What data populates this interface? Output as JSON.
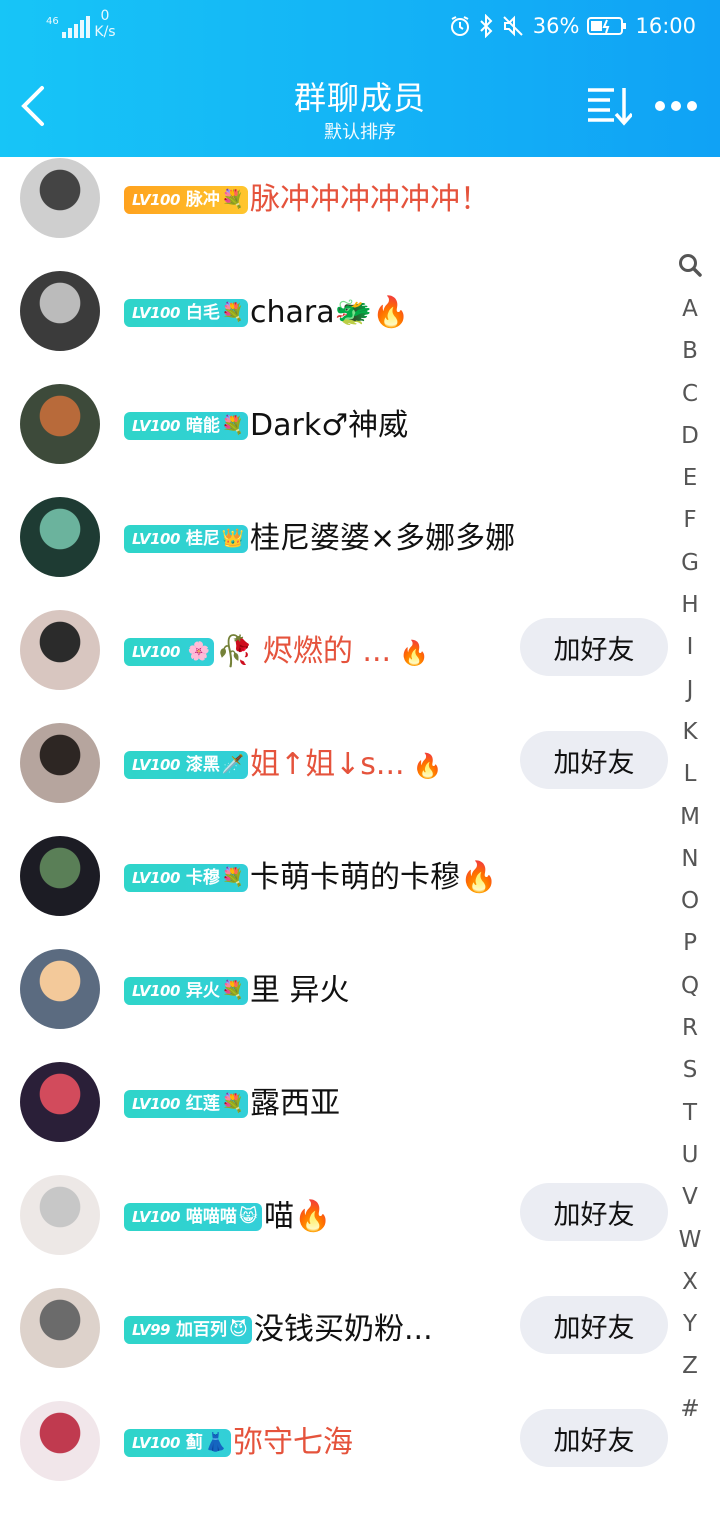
{
  "status_bar": {
    "network_type": "46",
    "net_speed_value": "0",
    "net_speed_unit": "K/s",
    "battery_percent": "36%",
    "time": "16:00"
  },
  "header": {
    "title": "群聊成员",
    "subtitle": "默认排序"
  },
  "add_friend_label": "加好友",
  "members": [
    {
      "level": "LV100",
      "title": "脉冲",
      "title_emoji": "💐",
      "name": "脉冲冲冲冲冲冲！",
      "name_red": true,
      "suffix": "",
      "badge_gold": true,
      "add_friend": false
    },
    {
      "level": "LV100",
      "title": "白毛",
      "title_emoji": "💐",
      "name": "chara🐲🔥",
      "name_red": false,
      "suffix": "",
      "badge_gold": false,
      "add_friend": false
    },
    {
      "level": "LV100",
      "title": "暗能",
      "title_emoji": "💐",
      "name": "Dark♂神威",
      "name_red": false,
      "suffix": "",
      "badge_gold": false,
      "add_friend": false
    },
    {
      "level": "LV100",
      "title": "桂尼",
      "title_emoji": "👑",
      "name": "桂尼婆婆×多娜多娜",
      "name_red": false,
      "suffix": "",
      "badge_gold": false,
      "add_friend": false
    },
    {
      "level": "LV100",
      "title": "",
      "title_emoji": "🌸",
      "name": "🥀 烬燃的 ...",
      "name_red": true,
      "suffix": "🔥",
      "badge_gold": false,
      "add_friend": true
    },
    {
      "level": "LV100",
      "title": "漆黑",
      "title_emoji": "🗡️",
      "name": "姐↑姐↓s...",
      "name_red": true,
      "suffix": "🔥",
      "badge_gold": false,
      "add_friend": true
    },
    {
      "level": "LV100",
      "title": "卡穆",
      "title_emoji": "💐",
      "name": "卡萌卡萌的卡穆🔥",
      "name_red": false,
      "suffix": "",
      "badge_gold": false,
      "add_friend": false
    },
    {
      "level": "LV100",
      "title": "异火",
      "title_emoji": "💐",
      "name": "里 异火",
      "name_red": false,
      "suffix": "",
      "badge_gold": false,
      "add_friend": false
    },
    {
      "level": "LV100",
      "title": "红莲",
      "title_emoji": "💐",
      "name": "露西亚",
      "name_red": false,
      "suffix": "",
      "badge_gold": false,
      "add_friend": false
    },
    {
      "level": "LV100",
      "title": "喵喵喵",
      "title_emoji": "😸",
      "name": "喵🔥",
      "name_red": false,
      "suffix": "",
      "badge_gold": false,
      "add_friend": true
    },
    {
      "level": "LV99",
      "title": "加百列",
      "title_emoji": "😈",
      "name": "没钱买奶粉...",
      "name_red": false,
      "suffix": "",
      "badge_gold": false,
      "add_friend": true
    },
    {
      "level": "LV100",
      "title": "蓟",
      "title_emoji": "👗",
      "name": "弥守七海",
      "name_red": true,
      "suffix": "",
      "badge_gold": false,
      "add_friend": true
    }
  ],
  "index_letters": [
    "A",
    "B",
    "C",
    "D",
    "E",
    "F",
    "G",
    "H",
    "I",
    "J",
    "K",
    "L",
    "M",
    "N",
    "O",
    "P",
    "Q",
    "R",
    "S",
    "T",
    "U",
    "V",
    "W",
    "X",
    "Y",
    "Z",
    "#"
  ]
}
